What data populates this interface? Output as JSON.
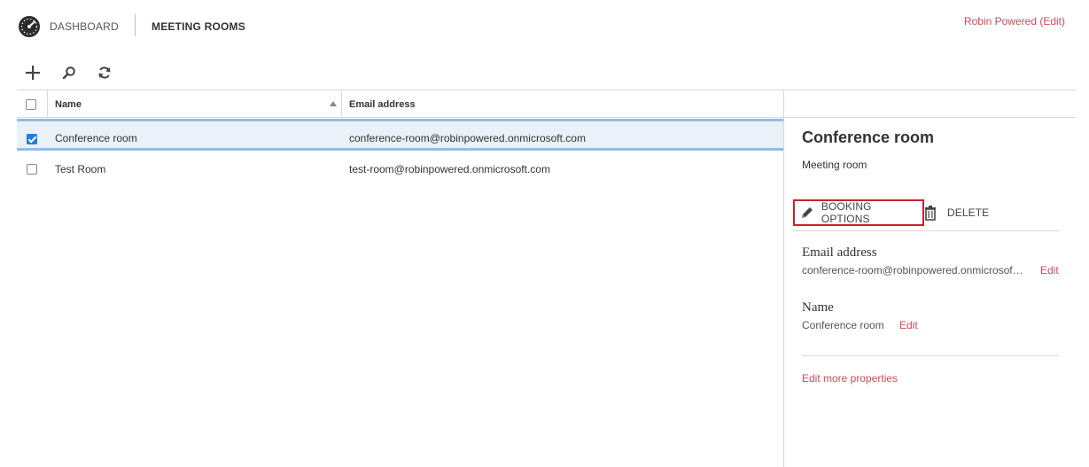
{
  "nav": {
    "dashboard_label": "DASHBOARD",
    "current_section": "MEETING ROOMS",
    "user_link": "Robin Powered (Edit)"
  },
  "toolbar": {
    "add_icon": "plus-icon",
    "search_icon": "search-icon",
    "refresh_icon": "refresh-icon"
  },
  "table": {
    "columns": [
      "Name",
      "Email address"
    ],
    "sort": "ascending",
    "rows": [
      {
        "name": "Conference room",
        "email": "conference-room@robinpowered.onmicrosoft.com",
        "checked": true
      },
      {
        "name": "Test Room",
        "email": "test-room@robinpowered.onmicrosoft.com",
        "checked": false
      }
    ]
  },
  "details": {
    "title": "Conference room",
    "subtitle": "Meeting room",
    "booking_label": "BOOKING OPTIONS",
    "delete_label": "DELETE",
    "email_label": "Email address",
    "email_value": "conference-room@robinpowered.onmicrosoft.com",
    "email_edit": "Edit",
    "name_label": "Name",
    "name_value": "Conference room",
    "name_edit": "Edit",
    "more_link": "Edit more properties"
  },
  "colors": {
    "accent": "#d6475a",
    "selection": "#1e7fd6",
    "highlight_border": "#c8212f"
  }
}
